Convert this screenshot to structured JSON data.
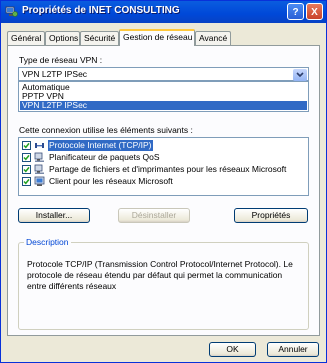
{
  "window": {
    "title": "Propriétés de INET CONSULTING",
    "help_label": "?",
    "close_label": "X"
  },
  "tabs": [
    "Général",
    "Options",
    "Sécurité",
    "Gestion de réseau",
    "Avancé"
  ],
  "vpn_type": {
    "label": "Type de réseau VPN :",
    "selected": "VPN L2TP IPSec",
    "options": [
      "Automatique",
      "PPTP VPN",
      "VPN L2TP IPSec"
    ]
  },
  "components": {
    "label": "Cette connexion utilise les éléments suivants :",
    "items": [
      {
        "label": "Protocole Internet (TCP/IP)",
        "checked": true,
        "selected": true,
        "icon": "network-protocol-icon"
      },
      {
        "label": "Planificateur de paquets QoS",
        "checked": true,
        "selected": false,
        "icon": "network-service-icon"
      },
      {
        "label": "Partage de fichiers et d'imprimantes pour les réseaux Microsoft",
        "checked": true,
        "selected": false,
        "icon": "network-service-icon"
      },
      {
        "label": "Client pour les réseaux Microsoft",
        "checked": true,
        "selected": false,
        "icon": "network-client-icon"
      }
    ]
  },
  "buttons": {
    "install": "Installer...",
    "uninstall": "Désinstaller",
    "properties": "Propriétés",
    "ok": "OK",
    "cancel": "Annuler"
  },
  "description": {
    "title": "Description",
    "text": "Protocole TCP/IP (Transmission Control Protocol/Internet Protocol). Le protocole de réseau étendu par défaut qui permet la communication entre différents réseaux"
  },
  "colors": {
    "titlebar": "#0048d8",
    "selection": "#316ac5",
    "dialog": "#ece9d8",
    "legend": "#0046d5"
  }
}
